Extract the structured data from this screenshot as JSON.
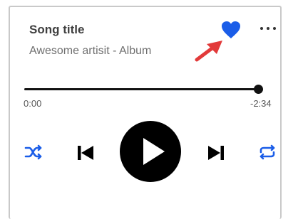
{
  "song": {
    "title": "Song title",
    "subtitle": "Awesome artisit - Album"
  },
  "progress": {
    "elapsed": "0:00",
    "remaining": "-2:34",
    "fraction": 0.995
  },
  "icons": {
    "favorite": "heart-icon",
    "more": "ellipsis-icon",
    "shuffle": "shuffle-icon",
    "previous": "skip-previous-icon",
    "play": "play-icon",
    "next": "skip-next-icon",
    "repeat": "repeat-icon",
    "annotation": "red-arrow-icon"
  },
  "colors": {
    "accent": "#1a5de8",
    "arrow": "#e23a3a",
    "text_primary": "#404040",
    "text_secondary": "#707070"
  }
}
